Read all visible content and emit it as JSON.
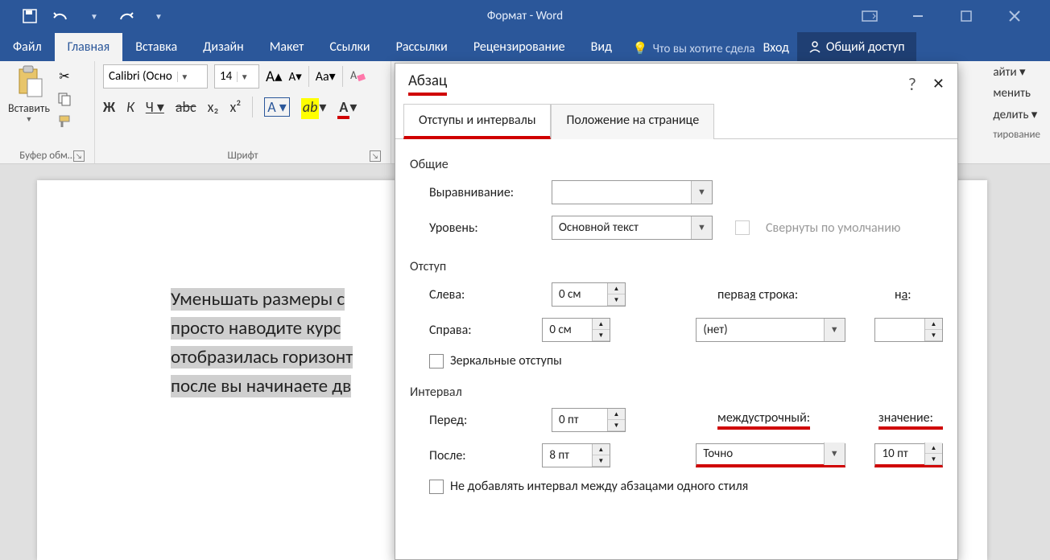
{
  "title": "Формат - Word",
  "tabs": {
    "file": "Файл",
    "home": "Главная",
    "insert": "Вставка",
    "design": "Дизайн",
    "layout": "Макет",
    "references": "Ссылки",
    "mailings": "Рассылки",
    "review": "Рецензирование",
    "view": "Вид"
  },
  "tellme": "Что вы хотите сдела",
  "login": "Вход",
  "share": "Общий доступ",
  "clipboard": {
    "paste": "Вставить",
    "label": "Буфер обм…"
  },
  "font": {
    "name": "Calibri (Осно",
    "size": "14",
    "bold": "Ж",
    "italic": "К",
    "underline": "Ч",
    "strike": "abc",
    "sub": "x₂",
    "sup": "x²",
    "label": "Шрифт"
  },
  "right": {
    "find": "айти",
    "replace": "менить",
    "select": "делить",
    "label": "тирование"
  },
  "doc": {
    "l1": "Уменьшать размеры с",
    "l2": "просто наводите курс",
    "l3": "отобразилась горизонт",
    "l4": "после вы начинаете дв"
  },
  "dialog": {
    "title": "Абзац",
    "tab1": "Отступы и интервалы",
    "tab2": "Положение на странице",
    "sect_general": "Общие",
    "alignment": "Выравнивание:",
    "level": "Уровень:",
    "level_val": "Основной текст",
    "collapsed": "Свернуты по умолчанию",
    "sect_indent": "Отступ",
    "left": "Слева:",
    "left_val": "0 см",
    "right": "Справа:",
    "right_val": "0 см",
    "firstline": "первая строка:",
    "firstline_val": "(нет)",
    "by": "на:",
    "mirror": "Зеркальные отступы",
    "sect_spacing": "Интервал",
    "before": "Перед:",
    "before_val": "0 пт",
    "after": "После:",
    "after_val": "8 пт",
    "linespacing": "междустрочный:",
    "linespacing_val": "Точно",
    "value": "значение:",
    "value_val": "10 пт",
    "nosame": "Не добавлять интервал между абзацами одного стиля"
  }
}
